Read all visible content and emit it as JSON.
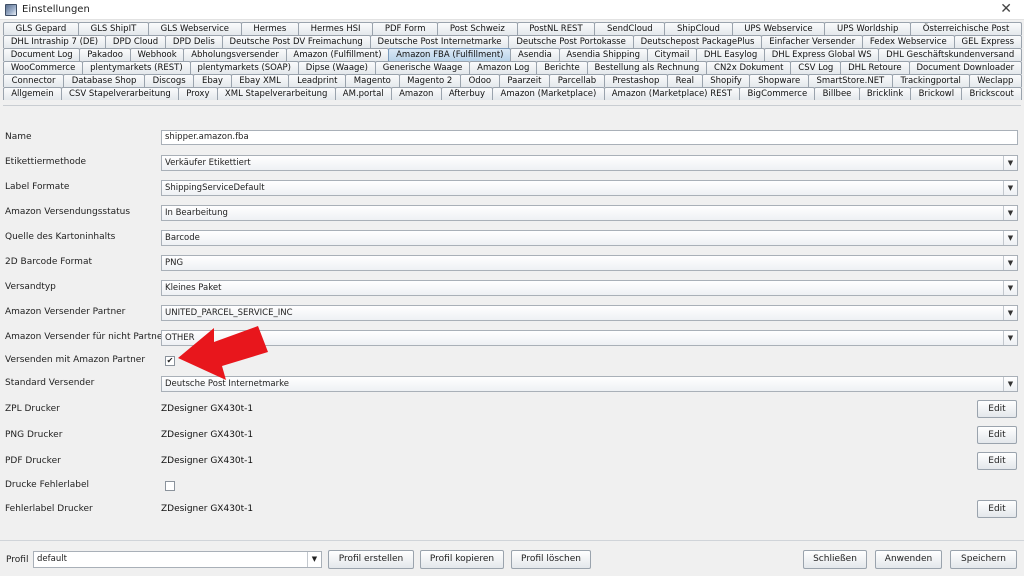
{
  "window": {
    "title": "Einstellungen",
    "close_glyph": "✕"
  },
  "tabs": {
    "rows": [
      [
        "GLS Gepard",
        "GLS ShipIT",
        "GLS Webservice",
        "Hermes",
        "Hermes HSI",
        "PDF Form",
        "Post Schweiz",
        "PostNL REST",
        "SendCloud",
        "ShipCloud",
        "UPS Webservice",
        "UPS Worldship",
        "Österreichische Post"
      ],
      [
        "DHL Intraship 7 (DE)",
        "DPD Cloud",
        "DPD Delis",
        "Deutsche Post DV Freimachung",
        "Deutsche Post Internetmarke",
        "Deutsche Post Portokasse",
        "Deutschepost PackagePlus",
        "Einfacher Versender",
        "Fedex Webservice",
        "GEL Express"
      ],
      [
        "Document Log",
        "Pakadoo",
        "Webhook",
        "Abholungsversender",
        "Amazon (Fulfillment)",
        "Amazon FBA (Fulfillment)",
        "Asendia",
        "Asendia Shipping",
        "Citymail",
        "DHL Easylog",
        "DHL Express Global WS",
        "DHL Geschäftskundenversand"
      ],
      [
        "WooCommerce",
        "plentymarkets (REST)",
        "plentymarkets (SOAP)",
        "Dipse (Waage)",
        "Generische Waage",
        "Amazon Log",
        "Berichte",
        "Bestellung als Rechnung",
        "CN2x Dokument",
        "CSV Log",
        "DHL Retoure",
        "Document Downloader"
      ],
      [
        "Connector",
        "Database Shop",
        "Discogs",
        "Ebay",
        "Ebay XML",
        "Leadprint",
        "Magento",
        "Magento 2",
        "Odoo",
        "Paarzeit",
        "Parcellab",
        "Prestashop",
        "Real",
        "Shopify",
        "Shopware",
        "SmartStore.NET",
        "Trackingportal",
        "Weclapp"
      ],
      [
        "Allgemein",
        "CSV Stapelverarbeitung",
        "Proxy",
        "XML Stapelverarbeitung",
        "AM.portal",
        "Amazon",
        "Afterbuy",
        "Amazon (Marketplace)",
        "Amazon (Marketplace) REST",
        "BigCommerce",
        "Billbee",
        "Bricklink",
        "Brickowl",
        "Brickscout"
      ]
    ],
    "active": "Amazon FBA (Fulfillment)"
  },
  "form": {
    "name": {
      "label": "Name",
      "value": "shipper.amazon.fba"
    },
    "etikettiermethode": {
      "label": "Etikettiermethode",
      "value": "Verkäufer Etikettiert"
    },
    "label_formate": {
      "label": "Label Formate",
      "value": "ShippingServiceDefault"
    },
    "versendungsstatus": {
      "label": "Amazon Versendungsstatus",
      "value": "In Bearbeitung"
    },
    "quelle": {
      "label": "Quelle des Kartoninhalts",
      "value": "Barcode"
    },
    "barcode_format": {
      "label": "2D Barcode Format",
      "value": "PNG"
    },
    "versandtyp": {
      "label": "Versandtyp",
      "value": "Kleines Paket"
    },
    "versender_partner": {
      "label": "Amazon Versender Partner",
      "value": "UNITED_PARCEL_SERVICE_INC"
    },
    "versender_nicht_partner": {
      "label": "Amazon Versender für nicht Partner",
      "value": "OTHER"
    },
    "versenden_partner": {
      "label": "Versenden mit Amazon Partner",
      "checked": true,
      "check_glyph": "✔"
    },
    "standard_versender": {
      "label": "Standard Versender",
      "value": "Deutsche Post Internetmarke"
    },
    "zpl_drucker": {
      "label": "ZPL Drucker",
      "value": "ZDesigner GX430t-1",
      "button": "Edit"
    },
    "png_drucker": {
      "label": "PNG Drucker",
      "value": "ZDesigner GX430t-1",
      "button": "Edit"
    },
    "pdf_drucker": {
      "label": "PDF Drucker",
      "value": "ZDesigner GX430t-1",
      "button": "Edit"
    },
    "drucke_fehlerlabel": {
      "label": "Drucke Fehlerlabel",
      "checked": false
    },
    "fehlerlabel_drucker": {
      "label": "Fehlerlabel Drucker",
      "value": "ZDesigner GX430t-1",
      "button": "Edit"
    }
  },
  "footer": {
    "profil_label": "Profil",
    "profil_value": "default",
    "buttons": {
      "erstellen": "Profil erstellen",
      "kopieren": "Profil kopieren",
      "loeschen": "Profil löschen",
      "schliessen": "Schließen",
      "anwenden": "Anwenden",
      "speichern": "Speichern"
    }
  },
  "colors": {
    "arrow": "#e8161c",
    "active_tab": "#b9d3ea"
  }
}
